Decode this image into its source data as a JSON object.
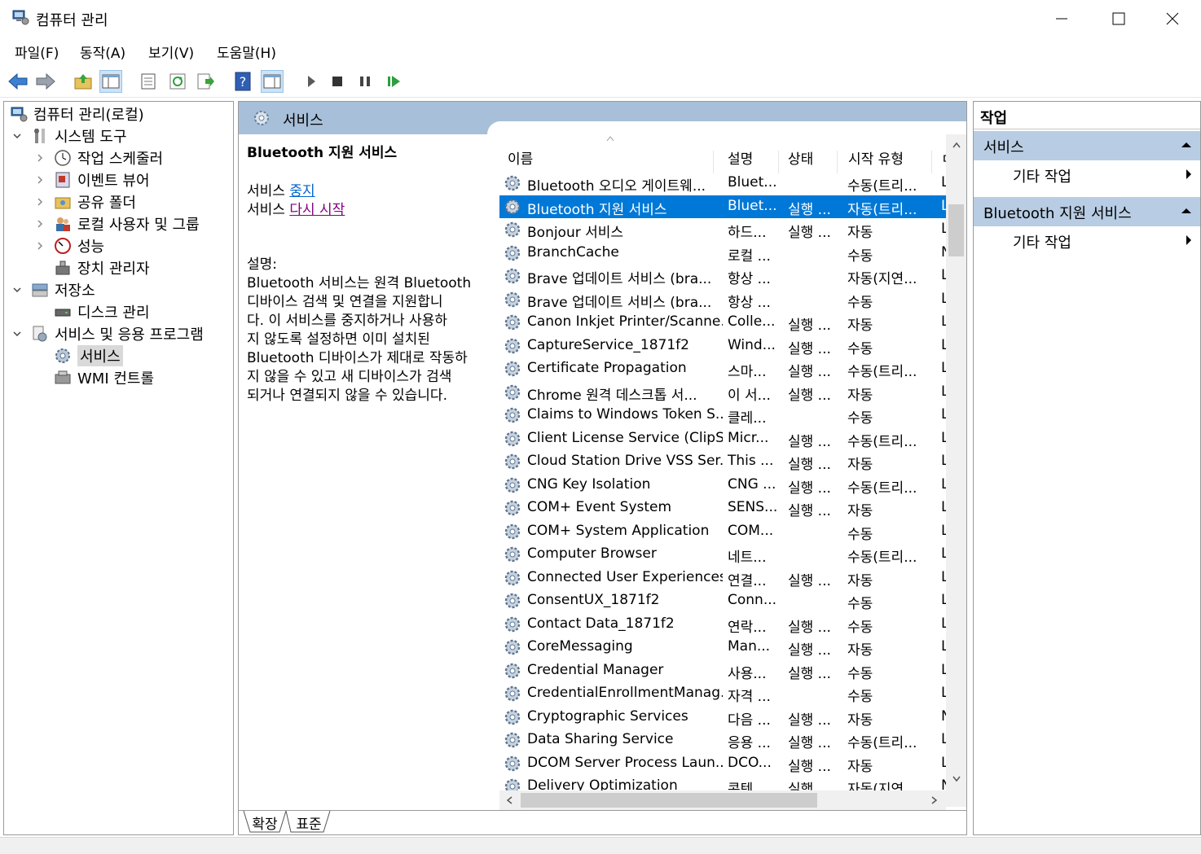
{
  "window": {
    "title": "컴퓨터 관리",
    "controls": [
      "minimize-icon",
      "maximize-icon",
      "close-icon"
    ]
  },
  "menu": [
    "파일(F)",
    "동작(A)",
    "보기(V)",
    "도움말(H)"
  ],
  "toolbar": [
    "back-arrow-icon",
    "forward-arrow-icon",
    "up-folder-icon",
    "show-hide-tree-icon",
    "properties-icon",
    "refresh-icon",
    "export-list-icon",
    "help-icon",
    "show-hide-action-pane-icon",
    "start-service-icon",
    "stop-service-icon",
    "pause-service-icon",
    "restart-service-icon"
  ],
  "tree": {
    "root": "컴퓨터 관리(로컬)",
    "system_tools": "시스템 도구",
    "task_scheduler": "작업 스케줄러",
    "event_viewer": "이벤트 뷰어",
    "shared_folders": "공유 폴더",
    "local_users": "로컬 사용자 및 그룹",
    "performance": "성능",
    "device_manager": "장치 관리자",
    "storage": "저장소",
    "disk_management": "디스크 관리",
    "services_apps": "서비스 및 응용 프로그램",
    "services": "서비스",
    "wmi": "WMI 컨트롤"
  },
  "center": {
    "header_title": "서비스",
    "selected_service": "Bluetooth 지원 서비스",
    "action_stop_prefix": "서비스 ",
    "action_stop_link": "중지",
    "action_restart_prefix": "서비스 ",
    "action_restart_link": "다시 시작",
    "desc_label": "설명:",
    "desc_lines": [
      "Bluetooth 서비스는 원격 Bluetooth",
      "디바이스 검색 및 연결을 지원합니",
      "다. 이 서비스를 중지하거나 사용하",
      "지 않도록 설정하면 이미 설치된",
      "Bluetooth 디바이스가 제대로 작동하",
      "지 않을 수 있고 새 디바이스가 검색",
      "되거나 연결되지 않을 수 있습니다."
    ],
    "columns": [
      "이름",
      "설명",
      "상태",
      "시작 유형",
      "ㄷ"
    ],
    "tabs": [
      "확장",
      "표준"
    ]
  },
  "services": [
    {
      "name": "Bluetooth 오디오 게이트웨...",
      "desc": "Bluet...",
      "status": "",
      "startup": "수동(트리...",
      "logon": "L"
    },
    {
      "name": "Bluetooth 지원 서비스",
      "desc": "Bluet...",
      "status": "실행 ...",
      "startup": "자동(트리...",
      "logon": "L",
      "selected": true
    },
    {
      "name": "Bonjour 서비스",
      "desc": "하드...",
      "status": "실행 ...",
      "startup": "자동",
      "logon": "L"
    },
    {
      "name": "BranchCache",
      "desc": "로컬 ...",
      "status": "",
      "startup": "수동",
      "logon": "N"
    },
    {
      "name": "Brave 업데이트 서비스 (bra...",
      "desc": "항상 ...",
      "status": "",
      "startup": "자동(지연...",
      "logon": "L"
    },
    {
      "name": "Brave 업데이트 서비스 (bra...",
      "desc": "항상 ...",
      "status": "",
      "startup": "수동",
      "logon": "L"
    },
    {
      "name": "Canon Inkjet Printer/Scanne...",
      "desc": "Colle...",
      "status": "실행 ...",
      "startup": "자동",
      "logon": "L"
    },
    {
      "name": "CaptureService_1871f2",
      "desc": "Wind...",
      "status": "실행 ...",
      "startup": "수동",
      "logon": "L"
    },
    {
      "name": "Certificate Propagation",
      "desc": "스마...",
      "status": "실행 ...",
      "startup": "수동(트리...",
      "logon": "L"
    },
    {
      "name": "Chrome 원격 데스크톱 서...",
      "desc": "이 서...",
      "status": "실행 ...",
      "startup": "자동",
      "logon": "L"
    },
    {
      "name": "Claims to Windows Token S...",
      "desc": "클레...",
      "status": "",
      "startup": "수동",
      "logon": "L"
    },
    {
      "name": "Client License Service (ClipS...",
      "desc": "Micr...",
      "status": "실행 ...",
      "startup": "수동(트리...",
      "logon": "L"
    },
    {
      "name": "Cloud Station Drive VSS Ser...",
      "desc": "This ...",
      "status": "실행 ...",
      "startup": "자동",
      "logon": "L"
    },
    {
      "name": "CNG Key Isolation",
      "desc": "CNG ...",
      "status": "실행 ...",
      "startup": "수동(트리...",
      "logon": "L"
    },
    {
      "name": "COM+ Event System",
      "desc": "SENS...",
      "status": "실행 ...",
      "startup": "자동",
      "logon": "L"
    },
    {
      "name": "COM+ System Application",
      "desc": "COM...",
      "status": "",
      "startup": "수동",
      "logon": "L"
    },
    {
      "name": "Computer Browser",
      "desc": "네트...",
      "status": "",
      "startup": "수동(트리...",
      "logon": "L"
    },
    {
      "name": "Connected User Experiences...",
      "desc": "연결...",
      "status": "실행 ...",
      "startup": "자동",
      "logon": "L"
    },
    {
      "name": "ConsentUX_1871f2",
      "desc": "Conn...",
      "status": "",
      "startup": "수동",
      "logon": "L"
    },
    {
      "name": "Contact Data_1871f2",
      "desc": "연락...",
      "status": "실행 ...",
      "startup": "수동",
      "logon": "L"
    },
    {
      "name": "CoreMessaging",
      "desc": "Man...",
      "status": "실행 ...",
      "startup": "자동",
      "logon": "L"
    },
    {
      "name": "Credential Manager",
      "desc": "사용...",
      "status": "실행 ...",
      "startup": "수동",
      "logon": "L"
    },
    {
      "name": "CredentialEnrollmentManag...",
      "desc": "자격 ...",
      "status": "",
      "startup": "수동",
      "logon": "L"
    },
    {
      "name": "Cryptographic Services",
      "desc": "다음 ...",
      "status": "실행 ...",
      "startup": "자동",
      "logon": "N"
    },
    {
      "name": "Data Sharing Service",
      "desc": "응용 ...",
      "status": "실행 ...",
      "startup": "수동(트리...",
      "logon": "L"
    },
    {
      "name": "DCOM Server Process Laun...",
      "desc": "DCO...",
      "status": "실행 ...",
      "startup": "자동",
      "logon": "L"
    },
    {
      "name": "Delivery Optimization",
      "desc": "콘텐...",
      "status": "실행 ...",
      "startup": "자동(지연...",
      "logon": "N"
    }
  ],
  "actions": {
    "title": "작업",
    "group1": "서비스",
    "group1_item": "기타 작업",
    "group2": "Bluetooth 지원 서비스",
    "group2_item": "기타 작업"
  },
  "colors": {
    "selection": "#0078d7",
    "pane_header": "#a7bfd9",
    "action_group": "#b8cde3",
    "link": "#0066cc",
    "visited_link": "#800080"
  }
}
